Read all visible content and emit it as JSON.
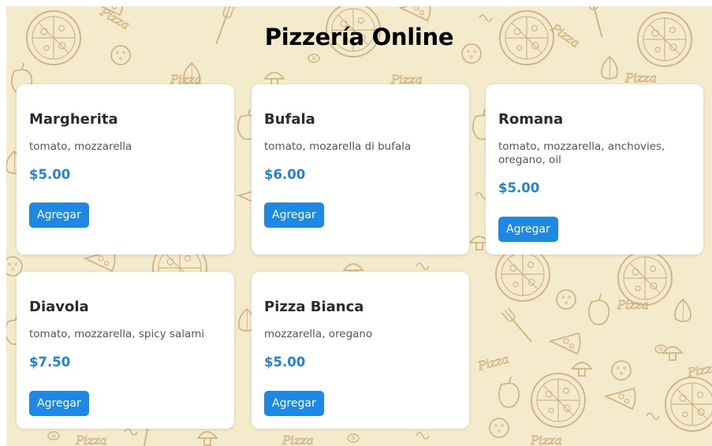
{
  "page": {
    "title": "Pizzería Online"
  },
  "menu": [
    {
      "name": "Margherita",
      "ingredients": "tomato, mozzarella",
      "price": "$5.00",
      "button_label": "Agregar"
    },
    {
      "name": "Bufala",
      "ingredients": "tomato, mozarella di bufala",
      "price": "$6.00",
      "button_label": "Agregar"
    },
    {
      "name": "Romana",
      "ingredients": "tomato, mozzarella, anchovies, oregano, oil",
      "price": "$5.00",
      "button_label": "Agregar"
    },
    {
      "name": "Diavola",
      "ingredients": "tomato, mozzarella, spicy salami",
      "price": "$7.50",
      "button_label": "Agregar"
    },
    {
      "name": "Pizza Bianca",
      "ingredients": "mozzarella, oregano",
      "price": "$5.00",
      "button_label": "Agregar"
    }
  ],
  "colors": {
    "background": "#f4ebcc",
    "pattern_ink": "#c9ad78",
    "price": "#2083d6",
    "button": "#1e88e5",
    "button_text": "#ffffff",
    "card": "#ffffff"
  },
  "background_pattern": {
    "icons": [
      "pizza-icon",
      "pizza-slice-icon",
      "tomato-slice-icon",
      "fork-icon",
      "knife-icon",
      "pepper-icon",
      "garlic-icon",
      "mushroom-icon",
      "olive-icon"
    ],
    "watermark_text": "Pizza"
  }
}
